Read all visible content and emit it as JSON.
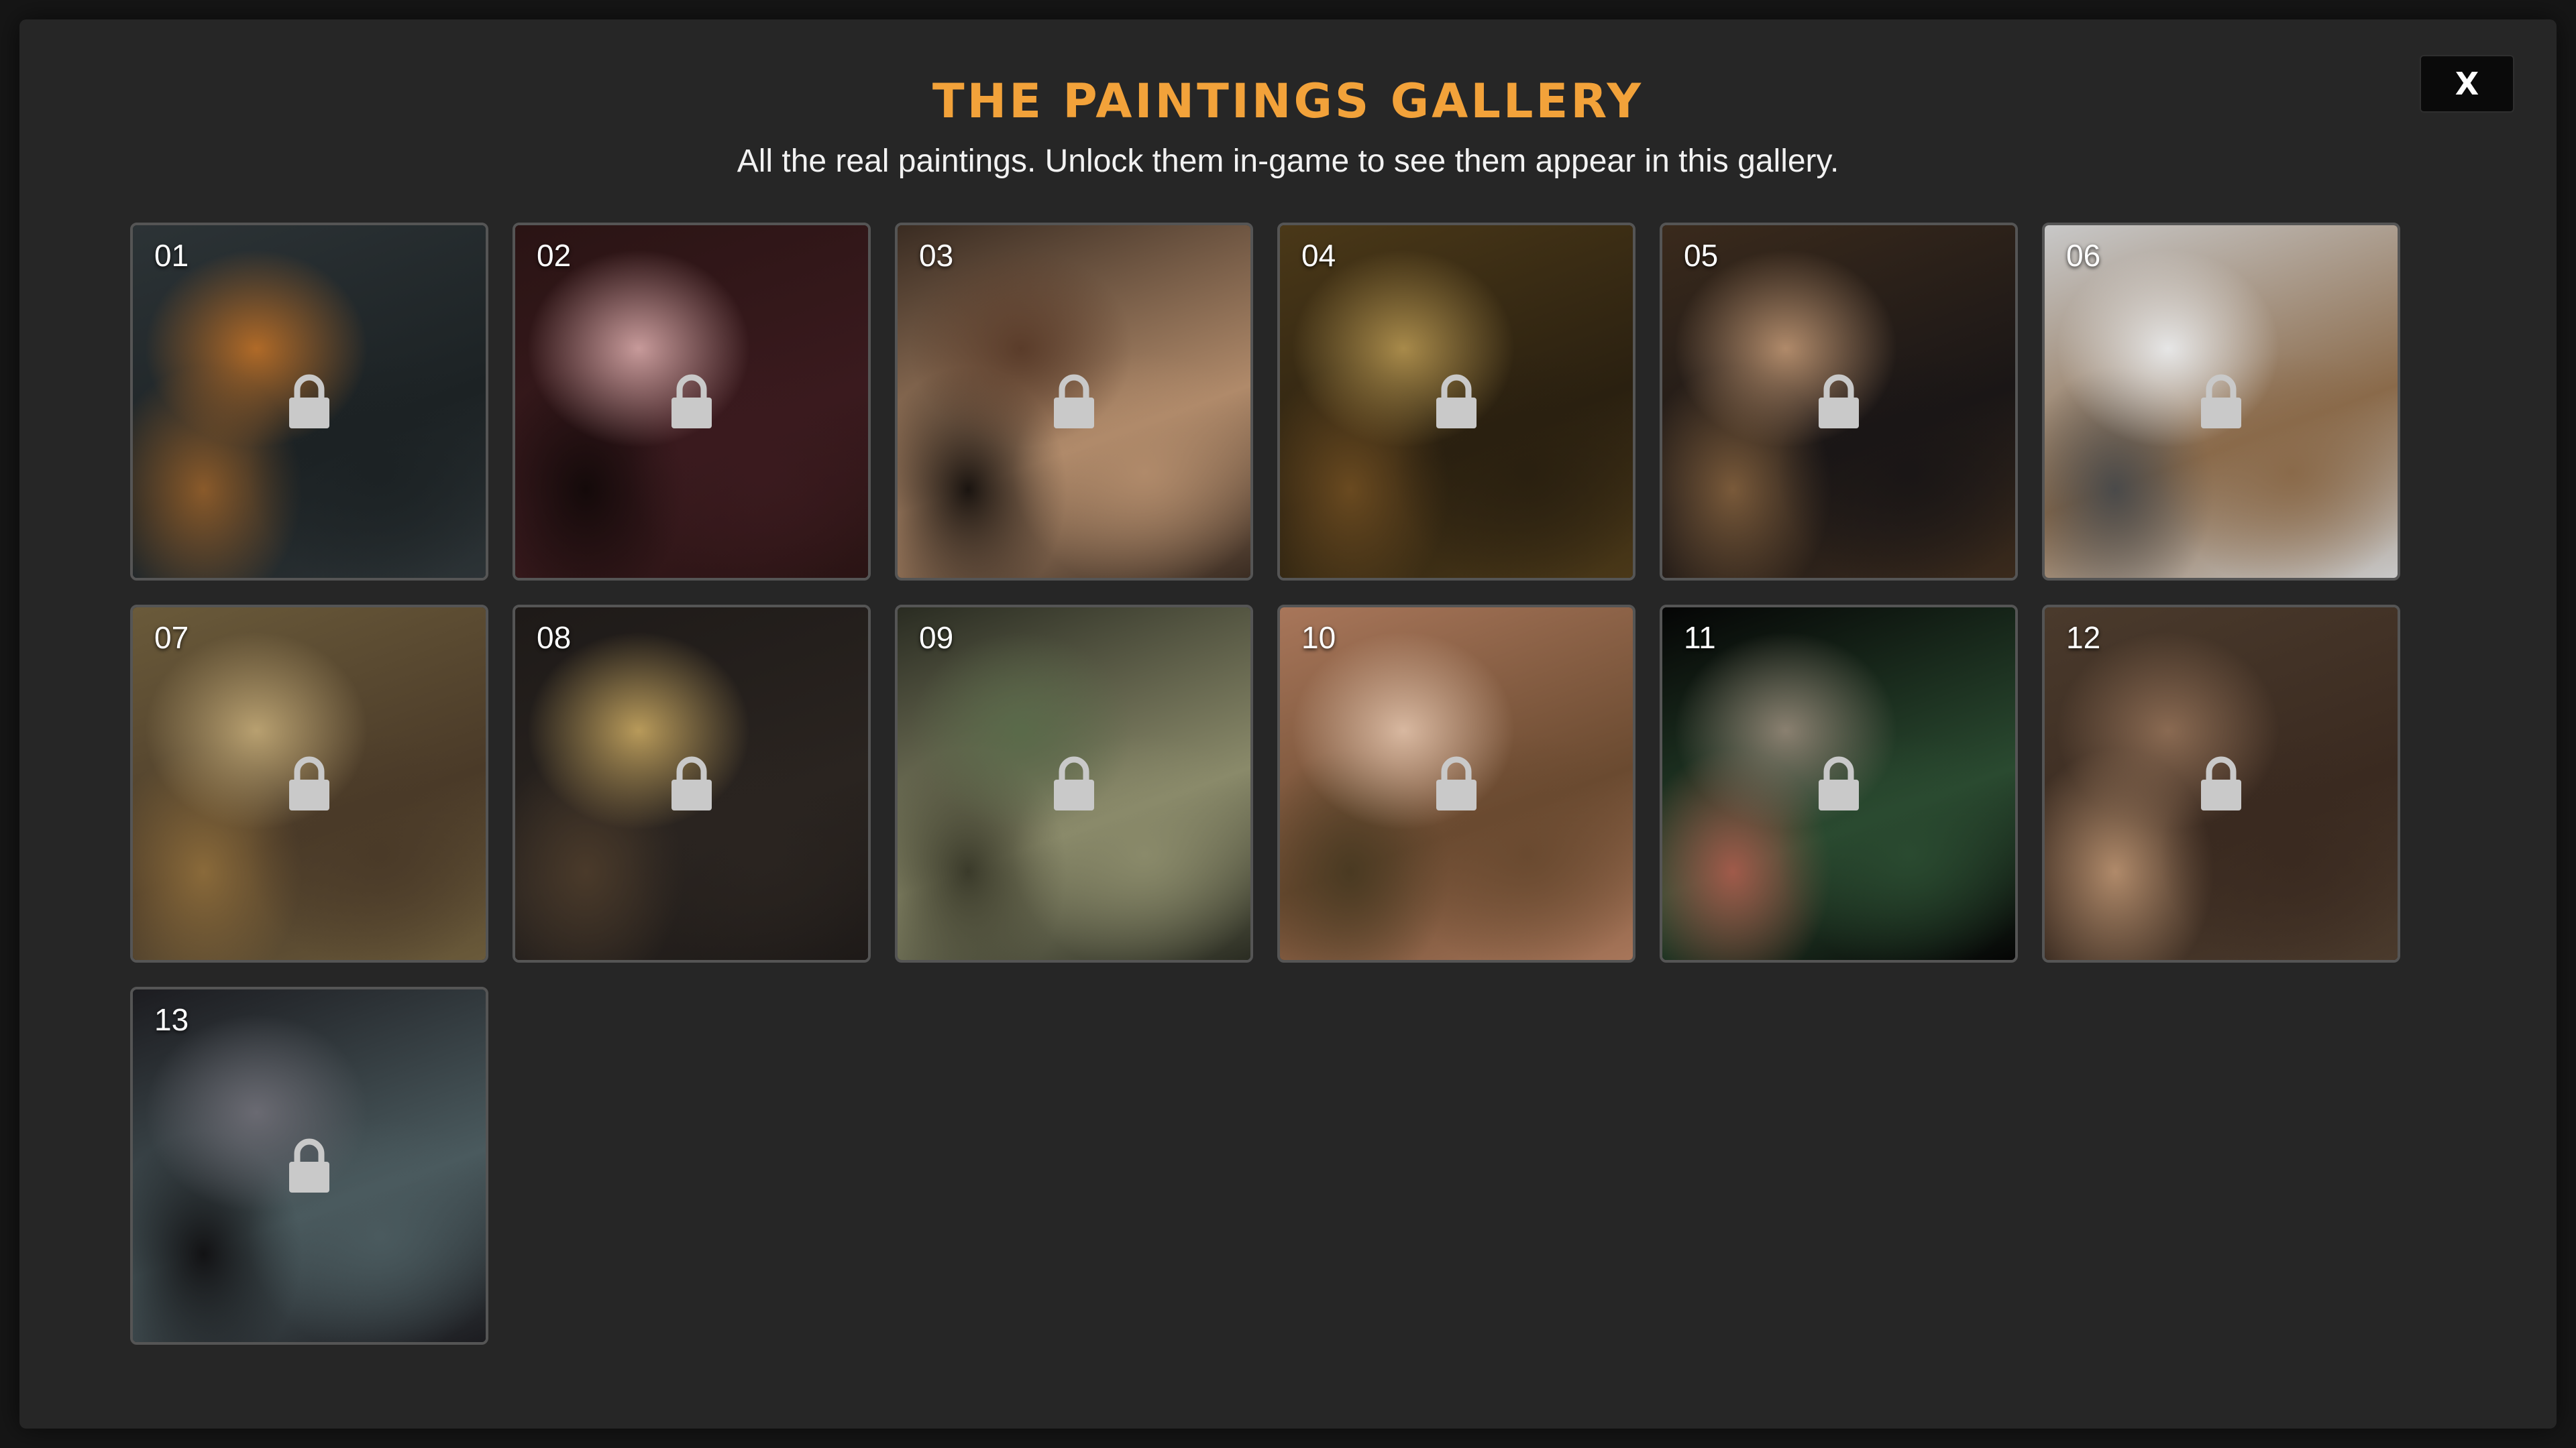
{
  "gallery": {
    "title": "THE PAINTINGS GALLERY",
    "subtitle": "All the real paintings. Unlock them in-game to see them appear in this gallery.",
    "close_label": "X",
    "colors": {
      "accent": "#f2a23a",
      "panel": "#262626",
      "lock": "#c9c9c9"
    },
    "paintings": [
      {
        "number": "01",
        "locked": true,
        "palette": [
          "#2c3336",
          "#b06a28",
          "#1c2224",
          "#8a5a2a"
        ]
      },
      {
        "number": "02",
        "locked": true,
        "palette": [
          "#2a1414",
          "#c79a9a",
          "#3a1a1e",
          "#140a0a"
        ]
      },
      {
        "number": "03",
        "locked": true,
        "palette": [
          "#3a2c22",
          "#5a3c2a",
          "#b08a6a",
          "#1a1410"
        ]
      },
      {
        "number": "04",
        "locked": true,
        "palette": [
          "#4a3818",
          "#a88a4a",
          "#2a2010",
          "#6a4a20"
        ]
      },
      {
        "number": "05",
        "locked": true,
        "palette": [
          "#3a2a1c",
          "#b08a6a",
          "#1a1616",
          "#7a5a3a"
        ]
      },
      {
        "number": "06",
        "locked": true,
        "palette": [
          "#c8c8c8",
          "#e6e6e6",
          "#8a6a4a",
          "#4a4a4a"
        ]
      },
      {
        "number": "07",
        "locked": true,
        "palette": [
          "#6a5a3a",
          "#b8a070",
          "#4a3a28",
          "#8a6a3a"
        ]
      },
      {
        "number": "08",
        "locked": true,
        "palette": [
          "#1e1a18",
          "#b89a5a",
          "#2a2420",
          "#4a3a2a"
        ]
      },
      {
        "number": "09",
        "locked": true,
        "palette": [
          "#2a2c22",
          "#5a6a4a",
          "#8a8a6a",
          "#3a3a2a"
        ]
      },
      {
        "number": "10",
        "locked": true,
        "palette": [
          "#a8765a",
          "#d8b8a0",
          "#6a4a30",
          "#4a3a22"
        ]
      },
      {
        "number": "11",
        "locked": true,
        "palette": [
          "#050505",
          "#8a8070",
          "#2a4a30",
          "#a05a4a"
        ]
      },
      {
        "number": "12",
        "locked": true,
        "palette": [
          "#4a3a2c",
          "#8a6a52",
          "#3a2a20",
          "#b08a6a"
        ]
      },
      {
        "number": "13",
        "locked": true,
        "palette": [
          "#1c1c20",
          "#6a6a72",
          "#4a5a5e",
          "#121214"
        ]
      }
    ]
  }
}
